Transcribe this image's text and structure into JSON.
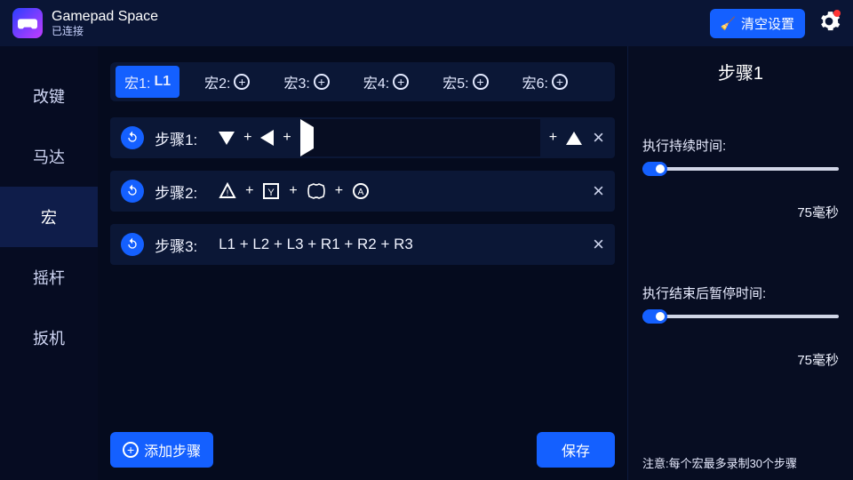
{
  "header": {
    "title": "Gamepad Space",
    "status": "已连接",
    "clear_label": "清空设置"
  },
  "sidebar": {
    "items": [
      {
        "label": "改键"
      },
      {
        "label": "马达"
      },
      {
        "label": "宏"
      },
      {
        "label": "摇杆"
      },
      {
        "label": "扳机"
      }
    ]
  },
  "tabs": {
    "prefix": "宏",
    "items": [
      {
        "n": "1",
        "value": "L1"
      },
      {
        "n": "2",
        "value": ""
      },
      {
        "n": "3",
        "value": ""
      },
      {
        "n": "4",
        "value": ""
      },
      {
        "n": "5",
        "value": ""
      },
      {
        "n": "6",
        "value": ""
      }
    ]
  },
  "steps": {
    "label_prefix": "步骤",
    "rows": [
      {
        "n": "1",
        "text_repr": "▼ + ◀ + ▶ + ▲"
      },
      {
        "n": "2",
        "text_repr": "△ + Y + X + A"
      },
      {
        "n": "3",
        "text_repr": "L1 + L2 + L3 + R1 + R2 + R3"
      }
    ],
    "add_label": "添加步骤",
    "save_label": "保存"
  },
  "right": {
    "title": "步骤1",
    "duration_label": "执行持续时间:",
    "duration_value": "75毫秒",
    "pause_label": "执行结束后暂停时间:",
    "pause_value": "75毫秒",
    "note": "注意:每个宏最多录制30个步骤"
  }
}
